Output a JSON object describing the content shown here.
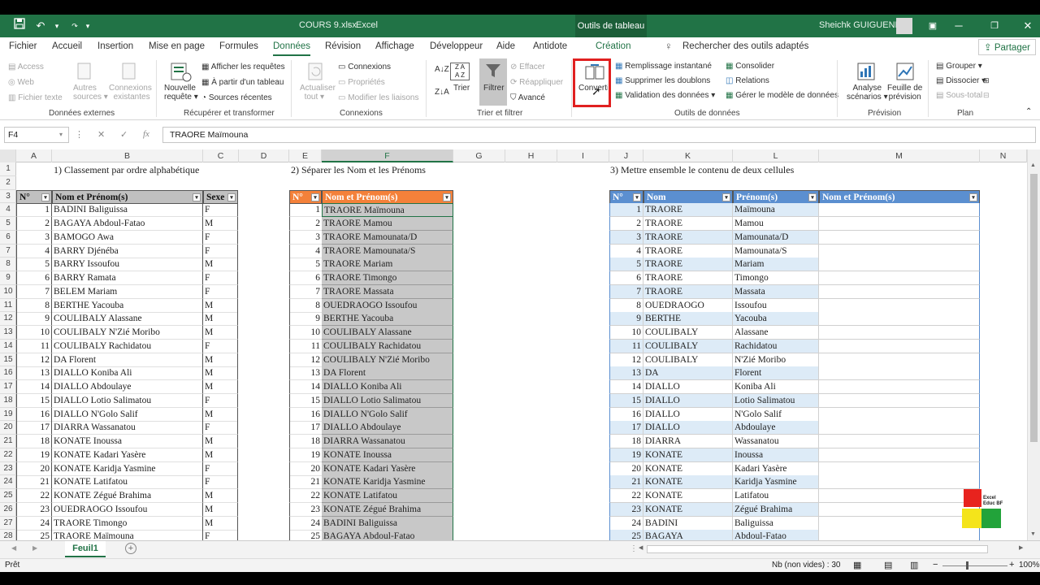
{
  "window": {
    "file": "COURS 9.xlsx",
    "app": "Excel",
    "context_tab": "Outils de tableau",
    "user": "Sheichk GUIGUENDE"
  },
  "tabs": [
    "Fichier",
    "Accueil",
    "Insertion",
    "Mise en page",
    "Formules",
    "Données",
    "Révision",
    "Affichage",
    "Développeur",
    "Aide",
    "Antidote",
    "Création"
  ],
  "active_tab": "Données",
  "search": "Rechercher des outils adaptés",
  "share": "Partager",
  "ribbon": {
    "ext": {
      "access": "Access",
      "web": "Web",
      "text": "Fichier texte",
      "other": "Autres",
      "other2": "sources",
      "existing": "Connexions",
      "existing2": "existantes",
      "label": "Données externes"
    },
    "query": {
      "new": "Nouvelle",
      "new2": "requête",
      "show": "Afficher les requêtes",
      "from_table": "À partir d'un tableau",
      "recent": "Sources récentes",
      "label": "Récupérer et transformer"
    },
    "conn": {
      "refresh": "Actualiser",
      "refresh2": "tout",
      "connections": "Connexions",
      "props": "Propriétés",
      "edit_links": "Modifier les liaisons",
      "label": "Connexions"
    },
    "sort": {
      "sort": "Trier",
      "filter": "Filtrer",
      "clear": "Effacer",
      "reapply": "Réappliquer",
      "advanced": "Avancé",
      "label": "Trier et filtrer"
    },
    "tools": {
      "convert": "Convertir",
      "flash": "Remplissage instantané",
      "dupes": "Supprimer les doublons",
      "validation": "Validation des données",
      "consolidate": "Consolider",
      "relations": "Relations",
      "model": "Gérer le modèle de données",
      "label": "Outils de données"
    },
    "forecast": {
      "whatif": "Analyse",
      "whatif2": "scénarios",
      "sheet": "Feuille de",
      "sheet2": "prévision",
      "label": "Prévision"
    },
    "outline": {
      "group": "Grouper",
      "ungroup": "Dissocier",
      "subtotal": "Sous-total",
      "label": "Plan"
    }
  },
  "namebox": "F4",
  "formula": "TRAORE Maïmouna",
  "columns": [
    "A",
    "B",
    "C",
    "D",
    "E",
    "F",
    "G",
    "H",
    "I",
    "J",
    "K",
    "L",
    "M",
    "N"
  ],
  "rows": [
    "1",
    "2",
    "3",
    "4",
    "5",
    "6",
    "7",
    "8",
    "9",
    "10",
    "11",
    "12",
    "13",
    "14",
    "15",
    "16",
    "17",
    "18",
    "19",
    "20",
    "21",
    "22",
    "23",
    "24",
    "25",
    "26",
    "27",
    "28"
  ],
  "titles": {
    "t1": "1) Classement par ordre alphabétique",
    "t2": "2) Séparer les Nom et les Prénoms",
    "t3": "3) Mettre ensemble le contenu de deux cellules"
  },
  "table1": {
    "headers": [
      "N°",
      "Nom et Prénom(s)",
      "Sexe"
    ],
    "rows": [
      [
        "1",
        "BADINI Baliguissa",
        "F"
      ],
      [
        "2",
        "BAGAYA Abdoul-Fatao",
        "M"
      ],
      [
        "3",
        "BAMOGO Awa",
        "F"
      ],
      [
        "4",
        "BARRY Djénéba",
        "F"
      ],
      [
        "5",
        "BARRY Issoufou",
        "M"
      ],
      [
        "6",
        "BARRY Ramata",
        "F"
      ],
      [
        "7",
        "BELEM Mariam",
        "F"
      ],
      [
        "8",
        "BERTHE Yacouba",
        "M"
      ],
      [
        "9",
        "COULIBALY Alassane",
        "M"
      ],
      [
        "10",
        "COULIBALY N'Zié Moribo",
        "M"
      ],
      [
        "11",
        "COULIBALY Rachidatou",
        "F"
      ],
      [
        "12",
        "DA Florent",
        "M"
      ],
      [
        "13",
        "DIALLO  Koniba Ali",
        "M"
      ],
      [
        "14",
        "DIALLO Abdoulaye",
        "M"
      ],
      [
        "15",
        "DIALLO Lotio Salimatou",
        "F"
      ],
      [
        "16",
        "DIALLO N'Golo Salif",
        "M"
      ],
      [
        "17",
        "DIARRA Wassanatou",
        "F"
      ],
      [
        "18",
        "KONATE Inoussa",
        "M"
      ],
      [
        "19",
        "KONATE Kadari Yasère",
        "M"
      ],
      [
        "20",
        "KONATE Karidja Yasmine",
        "F"
      ],
      [
        "21",
        "KONATE Latifatou",
        "F"
      ],
      [
        "22",
        "KONATE Zégué Brahima",
        "M"
      ],
      [
        "23",
        "OUEDRAOGO Issoufou",
        "M"
      ],
      [
        "24",
        "TRAORE  Timongo",
        "M"
      ],
      [
        "25",
        "TRAORE Maïmouna",
        "F"
      ]
    ]
  },
  "table2": {
    "headers": [
      "N°",
      "Nom et Prénom(s)"
    ],
    "rows": [
      [
        "1",
        "TRAORE Maïmouna"
      ],
      [
        "2",
        "TRAORE Mamou"
      ],
      [
        "3",
        "TRAORE Mamounata/D"
      ],
      [
        "4",
        "TRAORE Mamounata/S"
      ],
      [
        "5",
        "TRAORE Mariam"
      ],
      [
        "6",
        "TRAORE  Timongo"
      ],
      [
        "7",
        "TRAORE Massata"
      ],
      [
        "8",
        "OUEDRAOGO Issoufou"
      ],
      [
        "9",
        "BERTHE Yacouba"
      ],
      [
        "10",
        "COULIBALY Alassane"
      ],
      [
        "11",
        "COULIBALY Rachidatou"
      ],
      [
        "12",
        "COULIBALY N'Zié Moribo"
      ],
      [
        "13",
        "DA Florent"
      ],
      [
        "14",
        "DIALLO  Koniba Ali"
      ],
      [
        "15",
        "DIALLO Lotio Salimatou"
      ],
      [
        "16",
        "DIALLO N'Golo Salif"
      ],
      [
        "17",
        "DIALLO Abdoulaye"
      ],
      [
        "18",
        "DIARRA Wassanatou"
      ],
      [
        "19",
        "KONATE Inoussa"
      ],
      [
        "20",
        "KONATE Kadari Yasère"
      ],
      [
        "21",
        "KONATE Karidja Yasmine"
      ],
      [
        "22",
        "KONATE Latifatou"
      ],
      [
        "23",
        "KONATE Zégué Brahima"
      ],
      [
        "24",
        "BADINI Baliguissa"
      ],
      [
        "25",
        "BAGAYA Abdoul-Fatao"
      ]
    ]
  },
  "table3": {
    "headers": [
      "N°",
      "Nom",
      "Prénom(s)",
      "Nom et Prénom(s)"
    ],
    "rows": [
      [
        "1",
        "TRAORE",
        "Maïmouna"
      ],
      [
        "2",
        "TRAORE",
        "Mamou"
      ],
      [
        "3",
        "TRAORE",
        "Mamounata/D"
      ],
      [
        "4",
        "TRAORE",
        "Mamounata/S"
      ],
      [
        "5",
        "TRAORE",
        "Mariam"
      ],
      [
        "6",
        "TRAORE",
        "Timongo"
      ],
      [
        "7",
        "TRAORE",
        "Massata"
      ],
      [
        "8",
        "OUEDRAOGO",
        "Issoufou"
      ],
      [
        "9",
        "BERTHE",
        "Yacouba"
      ],
      [
        "10",
        "COULIBALY",
        "Alassane"
      ],
      [
        "11",
        "COULIBALY",
        "Rachidatou"
      ],
      [
        "12",
        "COULIBALY",
        "N'Zié Moribo"
      ],
      [
        "13",
        "DA",
        "Florent"
      ],
      [
        "14",
        "DIALLO",
        "Koniba Ali"
      ],
      [
        "15",
        "DIALLO",
        "Lotio Salimatou"
      ],
      [
        "16",
        "DIALLO",
        "N'Golo Salif"
      ],
      [
        "17",
        "DIALLO",
        "Abdoulaye"
      ],
      [
        "18",
        "DIARRA",
        "Wassanatou"
      ],
      [
        "19",
        "KONATE",
        "Inoussa"
      ],
      [
        "20",
        "KONATE",
        "Kadari Yasère"
      ],
      [
        "21",
        "KONATE",
        "Karidja Yasmine"
      ],
      [
        "22",
        "KONATE",
        "Latifatou"
      ],
      [
        "23",
        "KONATE",
        "Zégué Brahima"
      ],
      [
        "24",
        "BADINI",
        "Baliguissa"
      ],
      [
        "25",
        "BAGAYA",
        "Abdoul-Fatao"
      ]
    ]
  },
  "sheet_tab": "Feuil1",
  "status": {
    "ready": "Prêt",
    "count": "Nb (non vides) : 30",
    "zoom": "100%"
  },
  "logo": {
    "line1": "Excel",
    "line2": "Educ BF"
  },
  "colors": {
    "excel_green": "#217346",
    "orange_header": "#f4813a",
    "blue_header": "#5b8fd0",
    "light_blue": "#ddebf7",
    "gray_fill": "#c8c8c8",
    "highlight_red": "#e02020"
  }
}
